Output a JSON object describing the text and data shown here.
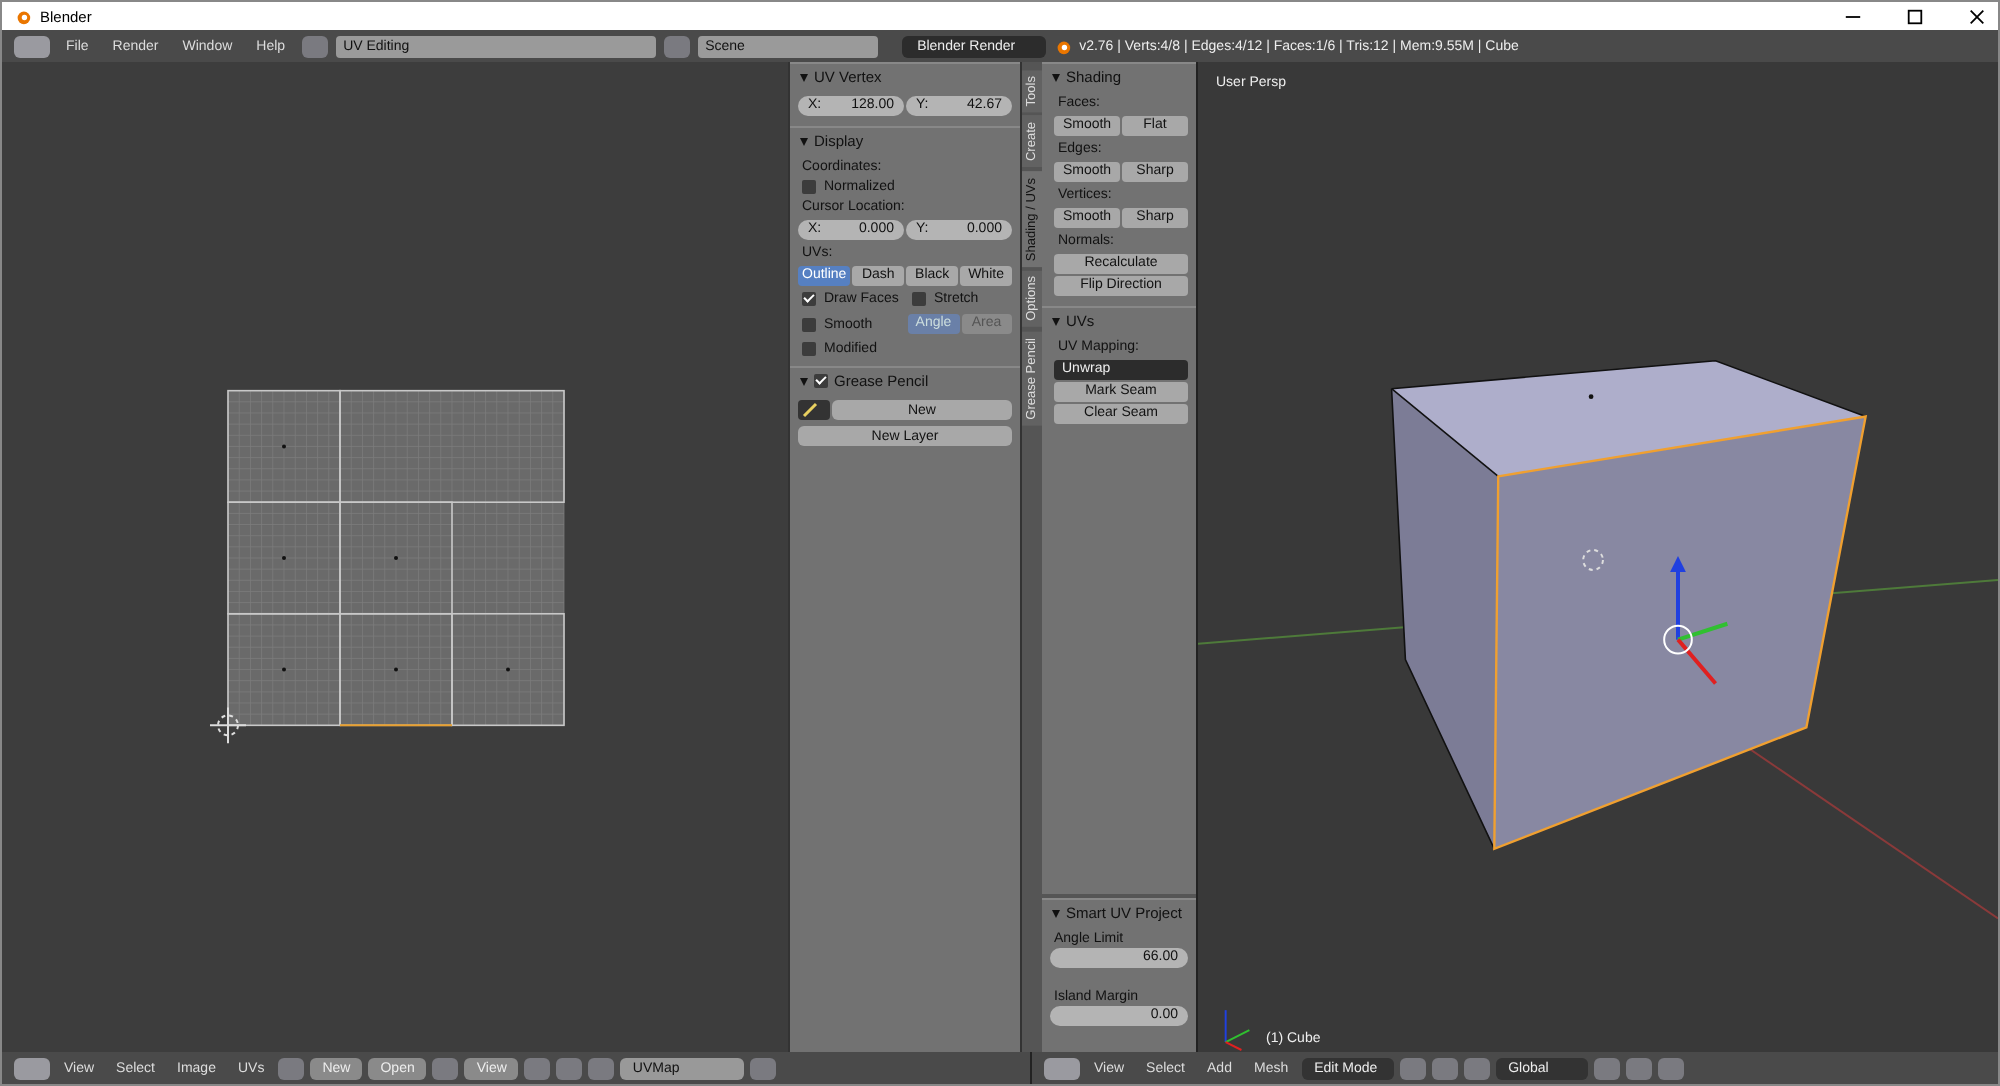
{
  "window": {
    "title": "Blender"
  },
  "top_header": {
    "menus": [
      "File",
      "Render",
      "Window",
      "Help"
    ],
    "layout": "UV Editing",
    "scene": "Scene",
    "engine": "Blender Render",
    "stats": "v2.76 | Verts:4/8 | Edges:4/12 | Faces:1/6 | Tris:12 | Mem:9.55M | Cube"
  },
  "properties": {
    "uv_vertex": {
      "title": "UV Vertex",
      "fields": [
        {
          "label": "X:",
          "value": "128.00"
        },
        {
          "label": "Y:",
          "value": "42.67"
        }
      ]
    },
    "display": {
      "title": "Display",
      "coordinates_label": "Coordinates:",
      "normalized": {
        "label": "Normalized",
        "checked": false
      },
      "cursor_label": "Cursor Location:",
      "cursor": [
        {
          "label": "X:",
          "value": "0.000"
        },
        {
          "label": "Y:",
          "value": "0.000"
        }
      ],
      "uvs_label": "UVs:",
      "uv_styles": [
        {
          "label": "Outline",
          "selected": true
        },
        {
          "label": "Dash",
          "selected": false
        },
        {
          "label": "Black",
          "selected": false
        },
        {
          "label": "White",
          "selected": false
        }
      ],
      "options": [
        {
          "label": "Draw Faces",
          "checked": true
        },
        {
          "label": "Stretch",
          "checked": false
        },
        {
          "label": "Smooth",
          "checked": false
        },
        {
          "label": "Modified",
          "checked": false
        }
      ],
      "stretch_modes": [
        {
          "label": "Angle",
          "selected": true
        },
        {
          "label": "Area",
          "selected": false
        }
      ]
    },
    "grease_pencil": {
      "title": "Grease Pencil",
      "checked": true,
      "new_button": "New",
      "new_layer_button": "New Layer"
    }
  },
  "tool_tabs": [
    {
      "label": "Tools",
      "selected": false
    },
    {
      "label": "Create",
      "selected": false
    },
    {
      "label": "Shading / UVs",
      "selected": true
    },
    {
      "label": "Options",
      "selected": false
    },
    {
      "label": "Grease Pencil",
      "selected": false
    }
  ],
  "tools": {
    "shading": {
      "title": "Shading",
      "groups": [
        {
          "label": "Faces:",
          "buttons": [
            "Smooth",
            "Flat"
          ]
        },
        {
          "label": "Edges:",
          "buttons": [
            "Smooth",
            "Sharp"
          ]
        },
        {
          "label": "Vertices:",
          "buttons": [
            "Smooth",
            "Sharp"
          ]
        }
      ],
      "normals_label": "Normals:",
      "normals_buttons": [
        "Recalculate",
        "Flip Direction"
      ]
    },
    "uvs": {
      "title": "UVs",
      "mapping_label": "UV Mapping:",
      "mapping": "Unwrap",
      "buttons": [
        "Mark Seam",
        "Clear Seam"
      ]
    }
  },
  "smart_uv_project": {
    "title": "Smart UV Project",
    "fields": [
      {
        "label": "Angle Limit",
        "value": "66.00"
      },
      {
        "label": "Island Margin",
        "value": "0.00"
      }
    ]
  },
  "viewport": {
    "view_label": "User Persp",
    "object_label": "(1) Cube"
  },
  "uv_header": {
    "menus": [
      "View",
      "Select",
      "Image",
      "UVs"
    ],
    "new_button": "New",
    "open_button": "Open",
    "view": "View",
    "uv_map": "UVMap"
  },
  "view3d_header": {
    "menus": [
      "View",
      "Select",
      "Add",
      "Mesh"
    ],
    "mode": "Edit Mode",
    "orientation": "Global"
  }
}
